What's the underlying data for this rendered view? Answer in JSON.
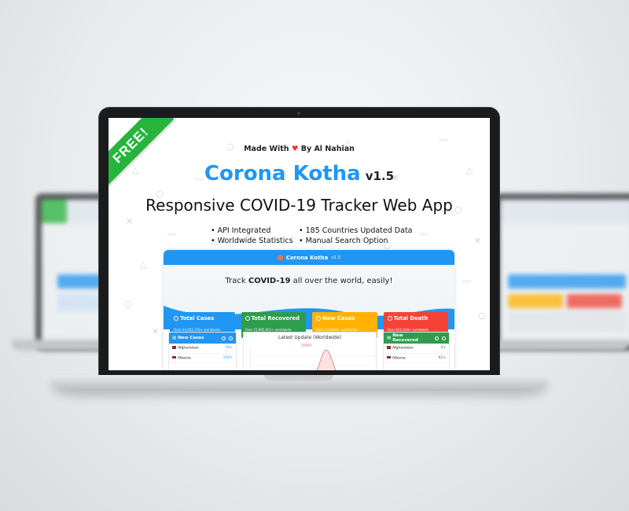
{
  "promo": {
    "badge": "FREE!",
    "made_with_prefix": "Made With",
    "made_with_heart": "♥",
    "made_with_suffix": "By Al Nahian",
    "app_name": "Corona Kotha",
    "version": "v1.5",
    "subtitle": "Responsive COVID-19 Tracker Web App",
    "features": [
      "• API Integrated",
      "• 185 Countries Updated Data",
      "• Worldwide Statistics",
      "• Manual Search Option"
    ]
  },
  "preview": {
    "header_title": "Corona Kotha",
    "header_version": "v1.5",
    "tagline_prefix": "Track",
    "tagline_bold": "COVID-19",
    "tagline_suffix": "all over the world, easily!",
    "cards": [
      {
        "title": "Total Cases",
        "sub": "Over 24,452,726+ worldwide.",
        "color": "#2196f3"
      },
      {
        "title": "Total Recovered",
        "sub": "Over 15,995,801+ worldwide.",
        "color": "#2e9d4d"
      },
      {
        "title": "New Cases",
        "sub": "Over 270,803+ worldwide.",
        "color": "#ffb300"
      },
      {
        "title": "Total Death",
        "sub": "Over 831,544+ worldwide.",
        "color": "#f44336"
      }
    ],
    "new_cases_panel": {
      "title": "New Cases",
      "color": "#2196f3",
      "rows": [
        {
          "country": "Afghanistan",
          "value": "16+"
        },
        {
          "country": "Albania",
          "value": "150+"
        }
      ]
    },
    "chart_title": "Latest Update (Worldwide)",
    "new_recovered_panel": {
      "title": "New Recovered",
      "color": "#2e9d4d",
      "rows": [
        {
          "country": "Afghanistan",
          "value": "4+"
        },
        {
          "country": "Albania",
          "value": "92+"
        }
      ]
    }
  }
}
